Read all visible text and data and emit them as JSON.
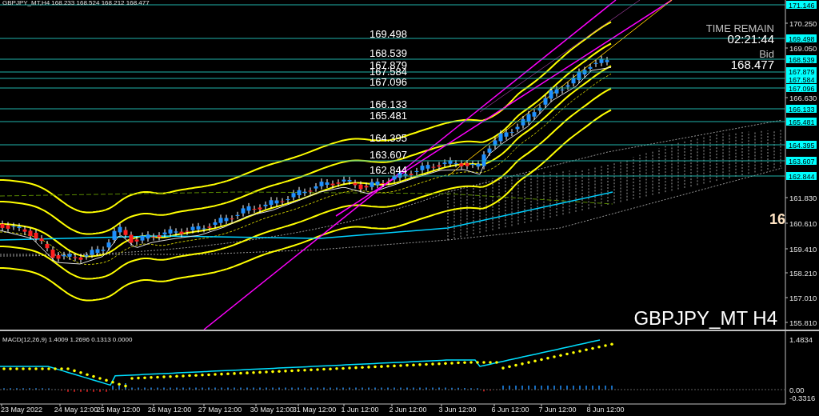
{
  "header": {
    "symbol": "GBPJPY_MT,H4",
    "ohlc": "168.233 168.524 168.212 168.477"
  },
  "info": {
    "time_label": "TIME REMAIN",
    "time_value": "02:21:44",
    "bid_label": "Bid",
    "bid_value": "168.477"
  },
  "levels": [
    {
      "axis_label": "171.146"
    },
    {
      "line_label": "169.498",
      "axis_label": "169.498"
    },
    {
      "line_label": "168.539",
      "axis_label": "168.539"
    },
    {
      "line_label": "167.879",
      "axis_label": "167.879"
    },
    {
      "line_label": "167.584",
      "axis_label": "167.584"
    },
    {
      "line_label": "167.096",
      "axis_label": "167.096"
    },
    {
      "line_label": "166.133",
      "axis_label": "166.133"
    },
    {
      "line_label": "165.481",
      "axis_label": "165.481"
    },
    {
      "line_label": "164.395",
      "axis_label": "164.395"
    },
    {
      "line_label": "163.607",
      "axis_label": "163.607"
    },
    {
      "line_label": "162.844",
      "axis_label": "162.844"
    }
  ],
  "price_axis": [
    "170.250",
    "169.050",
    "166.630",
    "161.830",
    "160.610",
    "159.410",
    "158.210",
    "157.010",
    "155.810"
  ],
  "cut_label": "16",
  "chart_title": "GBPJPY_MT H4",
  "macd": {
    "label": "MACD(12,26,9) 1.4009 1.2696 0.1313 0.0000",
    "axis": [
      "1.4834",
      "0.00",
      "-0.3316"
    ]
  },
  "time_axis": [
    "23 May 2022",
    "24 May 12:00",
    "25 May 12:00",
    "26 May 12:00",
    "27 May 12:00",
    "30 May 12:00",
    "31 May 12:00",
    "1 Jun 12:00",
    "2 Jun 12:00",
    "3 Jun 12:00",
    "6 Jun 12:00",
    "7 Jun 12:00",
    "8 Jun 12:00"
  ]
}
